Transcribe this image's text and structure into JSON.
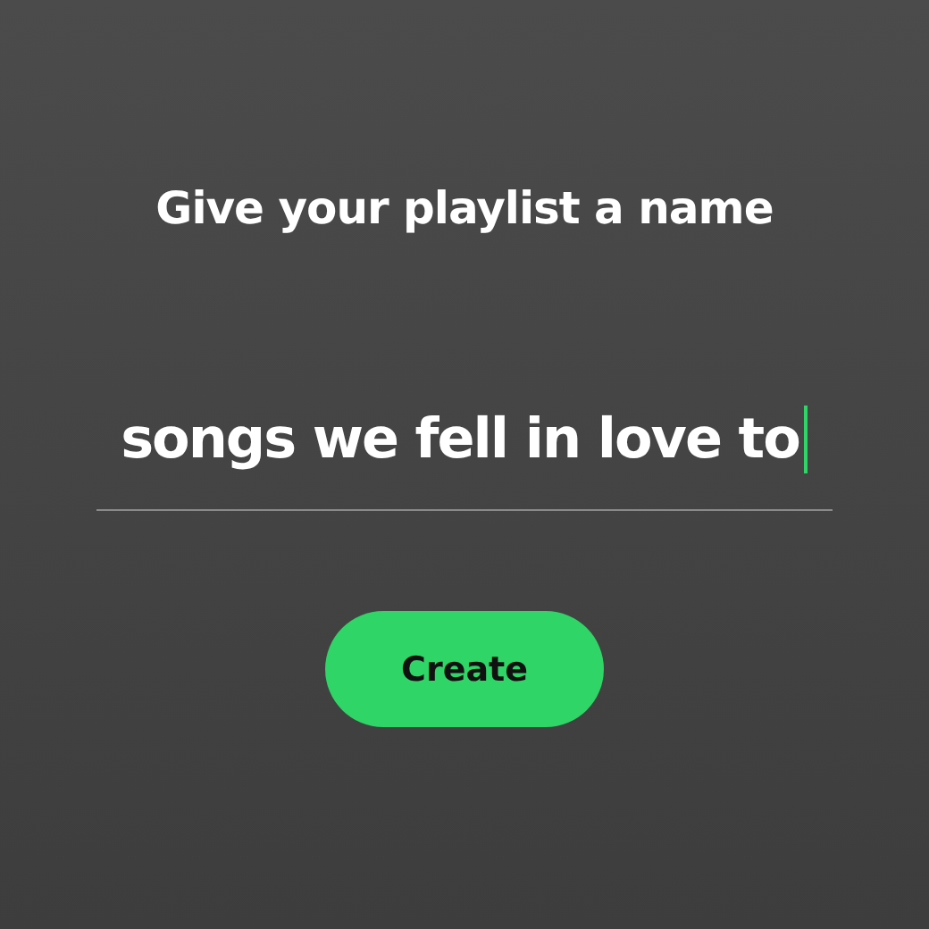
{
  "heading": "Give your playlist a name",
  "name_field": {
    "value": "songs we fell in love to",
    "focused": true
  },
  "create_button": {
    "label": "Create"
  }
}
